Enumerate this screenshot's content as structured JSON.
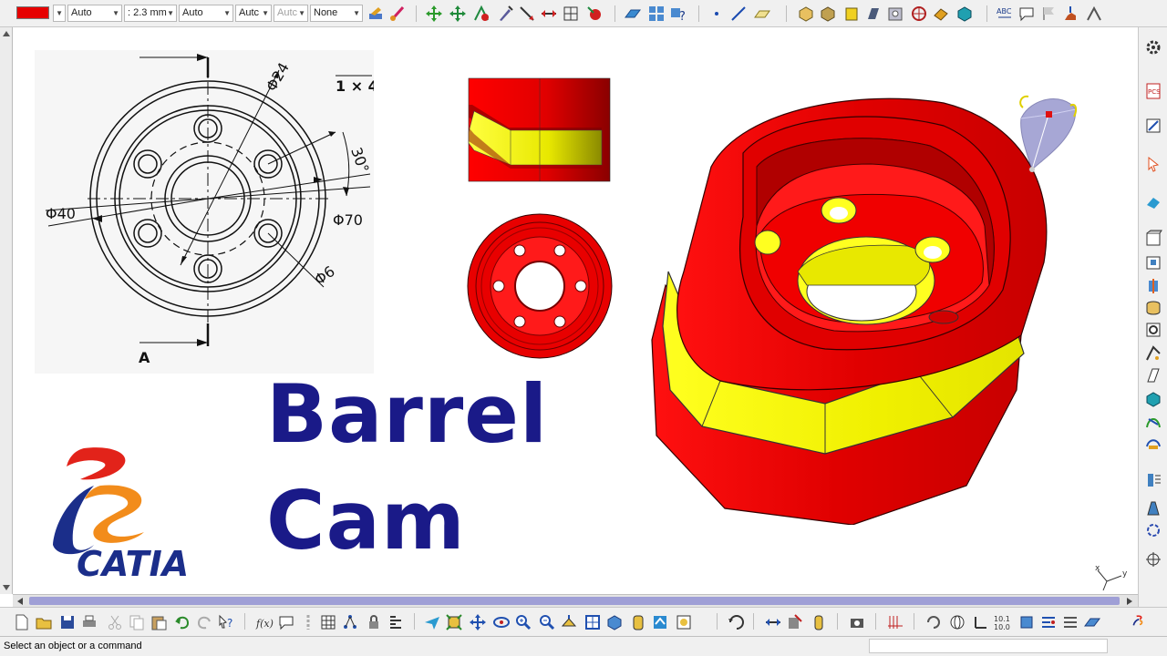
{
  "toolbar_top": {
    "color_swatch": "#e60000",
    "line_type": "Auto",
    "line_thickness": ": 2.3 mm",
    "point_type": "Auto",
    "layer": "Autc",
    "transparency": "Autc",
    "render_style": "None"
  },
  "drawing": {
    "dims": {
      "d24": "Φ24",
      "d40": "Φ40",
      "d70": "Φ70",
      "d6": "Φ6",
      "angle": "30°",
      "pattern": "1 × 4",
      "section": "A"
    }
  },
  "title": {
    "line1": "Barrel",
    "line2": "Cam"
  },
  "brand": {
    "name": "CATIA",
    "colors": {
      "red": "#e2231a",
      "orange": "#f28c1b",
      "blue": "#1b2e8a"
    }
  },
  "compass": {
    "x": "x",
    "y": "y"
  },
  "status": {
    "message": "Select an object or a command"
  },
  "colors": {
    "part_red": "#e60000",
    "part_yellow": "#ffff00",
    "title_blue": "#1a1a88"
  }
}
